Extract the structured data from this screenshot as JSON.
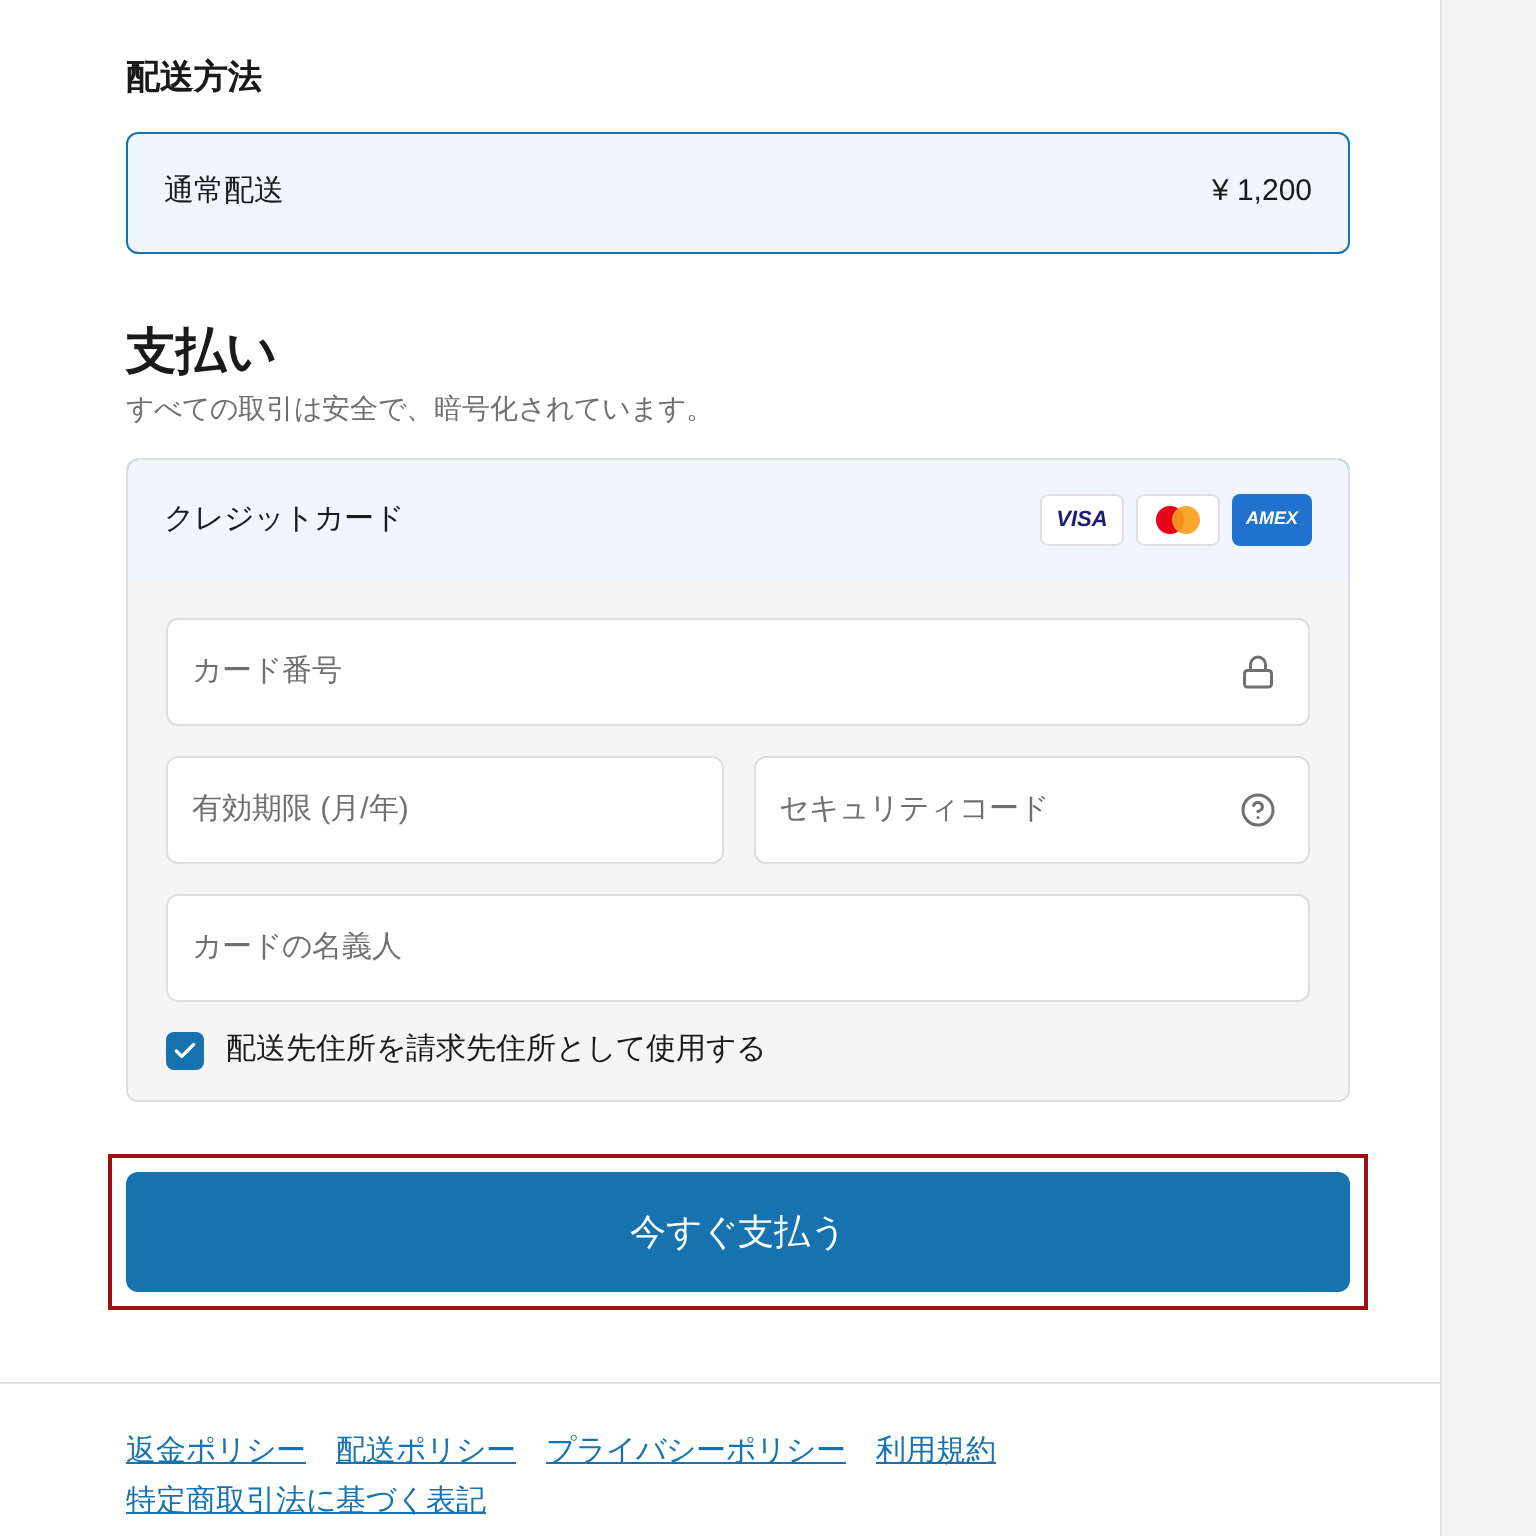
{
  "shipping": {
    "heading": "配送方法",
    "options": [
      {
        "label": "通常配送",
        "price": "¥ 1,200",
        "selected": true
      }
    ]
  },
  "payment": {
    "heading": "支払い",
    "subtitle": "すべての取引は安全で、暗号化されています。",
    "method": {
      "label": "クレジットカード",
      "selected": true,
      "brands": [
        {
          "kind": "visa",
          "label": "VISA"
        },
        {
          "kind": "mastercard"
        },
        {
          "kind": "amex",
          "label": "AMEX"
        }
      ]
    },
    "fields": {
      "card_number": {
        "placeholder": "カード番号"
      },
      "expiry": {
        "placeholder": "有効期限 (月/年)"
      },
      "security_code": {
        "placeholder": "セキュリティコード"
      },
      "name": {
        "placeholder": "カードの名義人"
      }
    },
    "billing_same": {
      "label": "配送先住所を請求先住所として使用する",
      "checked": true
    }
  },
  "pay_button": {
    "label": "今すぐ支払う",
    "focused": true
  },
  "footer_links": [
    {
      "label": "返金ポリシー"
    },
    {
      "label": "配送ポリシー"
    },
    {
      "label": "プライバシーポリシー"
    },
    {
      "label": "利用規約"
    },
    {
      "label": "特定商取引法に基づく表記"
    }
  ]
}
